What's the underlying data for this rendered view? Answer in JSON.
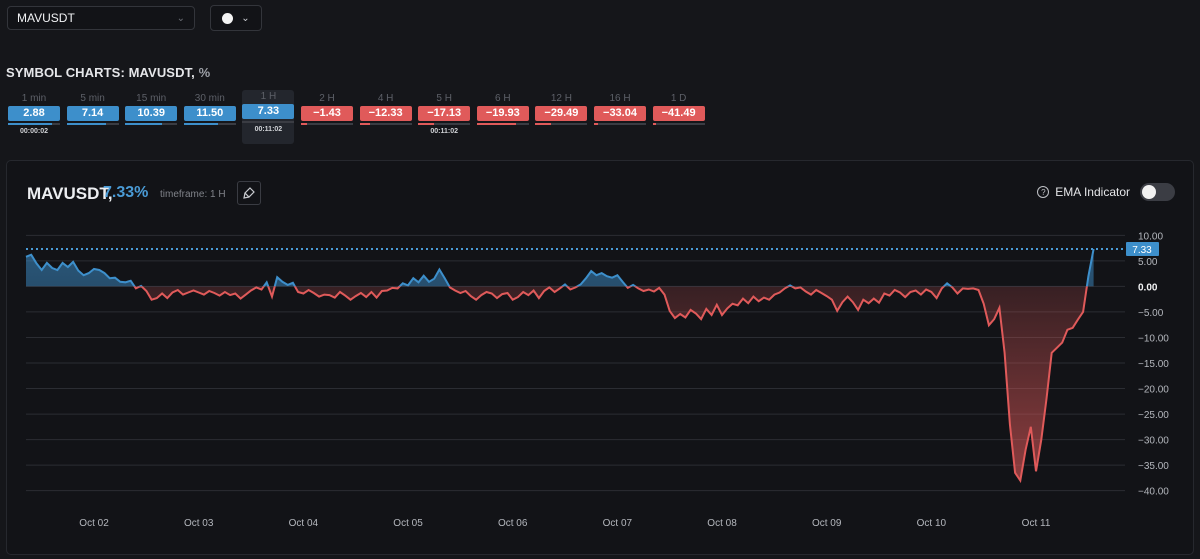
{
  "symbol_select": {
    "value": "MAVUSDT"
  },
  "section_title": {
    "text": "SYMBOL CHARTS: MAVUSDT,",
    "unit": "%"
  },
  "timeframes": [
    {
      "label": "1 min",
      "value": "2.88",
      "sign": "pos",
      "strength": 0.85,
      "timer": "00:00:02"
    },
    {
      "label": "5 min",
      "value": "7.14",
      "sign": "pos",
      "strength": 0.75,
      "timer": ""
    },
    {
      "label": "15 min",
      "value": "10.39",
      "sign": "pos",
      "strength": 0.7,
      "timer": ""
    },
    {
      "label": "30 min",
      "value": "11.50",
      "sign": "pos",
      "strength": 0.65,
      "timer": ""
    },
    {
      "label": "1 H",
      "value": "7.33",
      "sign": "pos",
      "strength": 0.0,
      "timer": "00:11:02"
    },
    {
      "label": "2 H",
      "value": "−1.43",
      "sign": "neg",
      "strength": 0.12,
      "timer": ""
    },
    {
      "label": "4 H",
      "value": "−12.33",
      "sign": "neg",
      "strength": 0.2,
      "timer": ""
    },
    {
      "label": "5 H",
      "value": "−17.13",
      "sign": "neg",
      "strength": 0.3,
      "timer": "00:11:02"
    },
    {
      "label": "6 H",
      "value": "−19.93",
      "sign": "neg",
      "strength": 0.75,
      "timer": ""
    },
    {
      "label": "12 H",
      "value": "−29.49",
      "sign": "neg",
      "strength": 0.3,
      "timer": ""
    },
    {
      "label": "16 H",
      "value": "−33.04",
      "sign": "neg",
      "strength": 0.08,
      "timer": ""
    },
    {
      "label": "1 D",
      "value": "−41.49",
      "sign": "neg",
      "strength": 0.06,
      "timer": ""
    }
  ],
  "chart_header": {
    "symbol": "MAVUSDT,",
    "change": "7.33%",
    "timeframe": "timeframe: 1 H"
  },
  "ema": {
    "label": "EMA Indicator",
    "enabled": false
  },
  "colors": {
    "positive": "#3d8fcb",
    "negative": "#e05a5a",
    "background": "#15161a"
  },
  "chart_data": {
    "type": "area",
    "ylim": [
      -43,
      13
    ],
    "yticks": [
      10,
      5,
      0,
      -5,
      -10,
      -15,
      -20,
      -25,
      -30,
      -35,
      -40
    ],
    "ytick_labels": [
      "10.00",
      "5.00",
      "0.00",
      "−5.00",
      "−10.00",
      "−15.00",
      "−20.00",
      "−25.00",
      "−30.00",
      "−35.00",
      "−40.00"
    ],
    "x_labels": [
      "Oct 02",
      "Oct 03",
      "Oct 04",
      "Oct 05",
      "Oct 06",
      "Oct 07",
      "Oct 08",
      "Oct 09",
      "Oct 10",
      "Oct 11"
    ],
    "x_range": [
      1.35,
      11.85
    ],
    "last_value": 7.33,
    "last_value_label": "7.33",
    "points": [
      [
        1.35,
        5.8
      ],
      [
        1.4,
        6.2
      ],
      [
        1.45,
        4.5
      ],
      [
        1.5,
        3.2
      ],
      [
        1.55,
        4.6
      ],
      [
        1.6,
        3.6
      ],
      [
        1.65,
        3.2
      ],
      [
        1.7,
        4.6
      ],
      [
        1.75,
        3.8
      ],
      [
        1.8,
        4.8
      ],
      [
        1.85,
        3.1
      ],
      [
        1.9,
        2.2
      ],
      [
        1.95,
        2.6
      ],
      [
        2.0,
        3.4
      ],
      [
        2.05,
        3.2
      ],
      [
        2.1,
        2.6
      ],
      [
        2.15,
        1.6
      ],
      [
        2.2,
        1.7
      ],
      [
        2.25,
        0.9
      ],
      [
        2.3,
        0.8
      ],
      [
        2.35,
        1.1
      ],
      [
        2.4,
        -0.4
      ],
      [
        2.45,
        0.1
      ],
      [
        2.5,
        -0.9
      ],
      [
        2.55,
        -2.6
      ],
      [
        2.6,
        -2.3
      ],
      [
        2.65,
        -1.4
      ],
      [
        2.7,
        -2.3
      ],
      [
        2.75,
        -1.2
      ],
      [
        2.8,
        -0.7
      ],
      [
        2.85,
        -1.6
      ],
      [
        2.9,
        -1.2
      ],
      [
        2.95,
        -0.8
      ],
      [
        3.0,
        -1.2
      ],
      [
        3.05,
        -1.6
      ],
      [
        3.1,
        -0.9
      ],
      [
        3.15,
        -1.3
      ],
      [
        3.2,
        -1.8
      ],
      [
        3.25,
        -1.1
      ],
      [
        3.3,
        -1.7
      ],
      [
        3.35,
        -1.4
      ],
      [
        3.4,
        -2.4
      ],
      [
        3.45,
        -1.6
      ],
      [
        3.5,
        -0.8
      ],
      [
        3.55,
        -0.2
      ],
      [
        3.6,
        -0.6
      ],
      [
        3.65,
        0.8
      ],
      [
        3.7,
        -2.0
      ],
      [
        3.75,
        1.8
      ],
      [
        3.8,
        0.9
      ],
      [
        3.85,
        0.3
      ],
      [
        3.9,
        0.7
      ],
      [
        3.95,
        -1.1
      ],
      [
        4.0,
        -1.4
      ],
      [
        4.05,
        -0.7
      ],
      [
        4.1,
        -1.3
      ],
      [
        4.15,
        -2.0
      ],
      [
        4.2,
        -1.6
      ],
      [
        4.25,
        -1.7
      ],
      [
        4.3,
        -2.2
      ],
      [
        4.35,
        -1.1
      ],
      [
        4.4,
        -1.8
      ],
      [
        4.45,
        -2.6
      ],
      [
        4.5,
        -1.9
      ],
      [
        4.55,
        -1.3
      ],
      [
        4.6,
        -2.1
      ],
      [
        4.65,
        -1.1
      ],
      [
        4.7,
        -2.2
      ],
      [
        4.75,
        -0.9
      ],
      [
        4.8,
        -0.8
      ],
      [
        4.85,
        -0.3
      ],
      [
        4.9,
        -0.4
      ],
      [
        4.95,
        0.6
      ],
      [
        5.0,
        0.2
      ],
      [
        5.05,
        1.6
      ],
      [
        5.1,
        0.8
      ],
      [
        5.15,
        2.1
      ],
      [
        5.2,
        0.9
      ],
      [
        5.25,
        1.5
      ],
      [
        5.3,
        3.3
      ],
      [
        5.35,
        1.6
      ],
      [
        5.4,
        -0.2
      ],
      [
        5.45,
        -0.8
      ],
      [
        5.5,
        -1.3
      ],
      [
        5.55,
        -0.9
      ],
      [
        5.6,
        -1.9
      ],
      [
        5.65,
        -2.6
      ],
      [
        5.7,
        -1.7
      ],
      [
        5.75,
        -1.1
      ],
      [
        5.8,
        -1.4
      ],
      [
        5.85,
        -2.3
      ],
      [
        5.9,
        -1.5
      ],
      [
        5.95,
        -1.3
      ],
      [
        6.0,
        -2.6
      ],
      [
        6.05,
        -2.1
      ],
      [
        6.1,
        -1.1
      ],
      [
        6.15,
        -1.7
      ],
      [
        6.2,
        -0.8
      ],
      [
        6.25,
        -2.3
      ],
      [
        6.3,
        -0.9
      ],
      [
        6.35,
        -0.2
      ],
      [
        6.4,
        -1.1
      ],
      [
        6.45,
        -0.4
      ],
      [
        6.5,
        0.4
      ],
      [
        6.55,
        -0.6
      ],
      [
        6.6,
        -0.2
      ],
      [
        6.65,
        0.4
      ],
      [
        6.7,
        1.6
      ],
      [
        6.75,
        3.0
      ],
      [
        6.8,
        2.2
      ],
      [
        6.85,
        2.6
      ],
      [
        6.9,
        2.0
      ],
      [
        6.95,
        1.7
      ],
      [
        7.0,
        2.2
      ],
      [
        7.05,
        0.9
      ],
      [
        7.1,
        -0.3
      ],
      [
        7.15,
        0.3
      ],
      [
        7.2,
        -0.4
      ],
      [
        7.25,
        -0.9
      ],
      [
        7.3,
        -0.6
      ],
      [
        7.35,
        -1.0
      ],
      [
        7.4,
        -0.3
      ],
      [
        7.45,
        -1.6
      ],
      [
        7.5,
        -4.8
      ],
      [
        7.55,
        -6.2
      ],
      [
        7.6,
        -5.4
      ],
      [
        7.65,
        -6.1
      ],
      [
        7.7,
        -4.6
      ],
      [
        7.75,
        -5.3
      ],
      [
        7.8,
        -6.4
      ],
      [
        7.85,
        -4.4
      ],
      [
        7.9,
        -5.6
      ],
      [
        7.95,
        -3.6
      ],
      [
        8.0,
        -5.6
      ],
      [
        8.05,
        -4.3
      ],
      [
        8.1,
        -3.4
      ],
      [
        8.15,
        -3.7
      ],
      [
        8.2,
        -2.4
      ],
      [
        8.25,
        -3.3
      ],
      [
        8.3,
        -2.0
      ],
      [
        8.35,
        -2.9
      ],
      [
        8.4,
        -2.2
      ],
      [
        8.45,
        -2.6
      ],
      [
        8.5,
        -1.6
      ],
      [
        8.55,
        -1.2
      ],
      [
        8.6,
        -0.4
      ],
      [
        8.65,
        0.2
      ],
      [
        8.7,
        -0.4
      ],
      [
        8.75,
        -0.2
      ],
      [
        8.8,
        -1.0
      ],
      [
        8.85,
        -1.6
      ],
      [
        8.9,
        -0.7
      ],
      [
        8.95,
        -1.3
      ],
      [
        9.0,
        -1.9
      ],
      [
        9.05,
        -2.6
      ],
      [
        9.1,
        -4.8
      ],
      [
        9.15,
        -3.1
      ],
      [
        9.2,
        -2.0
      ],
      [
        9.25,
        -3.1
      ],
      [
        9.3,
        -4.6
      ],
      [
        9.35,
        -2.6
      ],
      [
        9.4,
        -3.3
      ],
      [
        9.45,
        -2.4
      ],
      [
        9.5,
        -3.2
      ],
      [
        9.55,
        -1.4
      ],
      [
        9.6,
        -1.8
      ],
      [
        9.65,
        -0.7
      ],
      [
        9.7,
        -1.2
      ],
      [
        9.75,
        -2.1
      ],
      [
        9.8,
        -1.1
      ],
      [
        9.85,
        -0.8
      ],
      [
        9.9,
        -1.6
      ],
      [
        9.95,
        -0.6
      ],
      [
        10.0,
        -1.1
      ],
      [
        10.05,
        -2.3
      ],
      [
        10.1,
        -0.4
      ],
      [
        10.15,
        0.6
      ],
      [
        10.2,
        -0.2
      ],
      [
        10.25,
        -1.4
      ],
      [
        10.3,
        -0.4
      ],
      [
        10.35,
        -0.5
      ],
      [
        10.4,
        -0.4
      ],
      [
        10.45,
        -0.7
      ],
      [
        10.5,
        -3.4
      ],
      [
        10.55,
        -7.6
      ],
      [
        10.6,
        -6.4
      ],
      [
        10.65,
        -4.2
      ],
      [
        10.7,
        -13.0
      ],
      [
        10.75,
        -27.0
      ],
      [
        10.8,
        -36.5
      ],
      [
        10.85,
        -38.0
      ],
      [
        10.9,
        -32.0
      ],
      [
        10.95,
        -27.5
      ],
      [
        11.0,
        -36.2
      ],
      [
        11.05,
        -30.0
      ],
      [
        11.1,
        -22.0
      ],
      [
        11.15,
        -13.0
      ],
      [
        11.2,
        -12.0
      ],
      [
        11.25,
        -11.0
      ],
      [
        11.3,
        -8.5
      ],
      [
        11.35,
        -8.1
      ],
      [
        11.4,
        -6.5
      ],
      [
        11.45,
        -5.0
      ],
      [
        11.5,
        2.0
      ],
      [
        11.55,
        7.33
      ]
    ]
  }
}
